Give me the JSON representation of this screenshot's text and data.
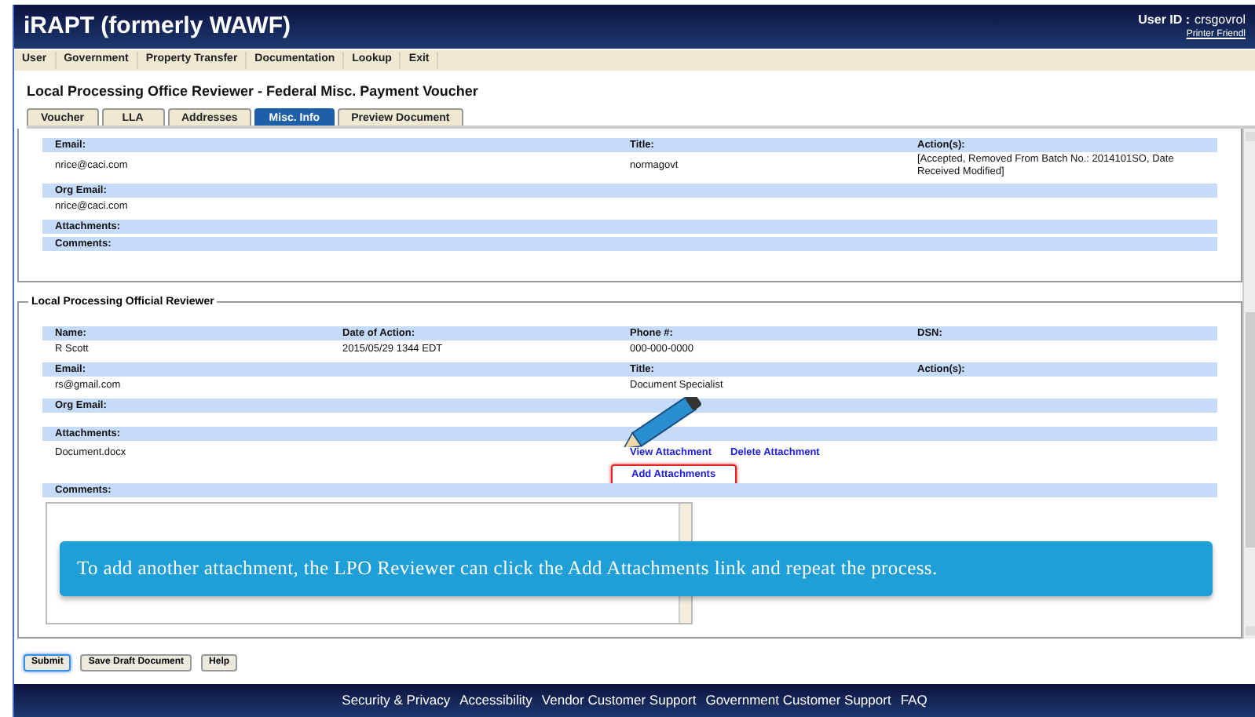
{
  "header": {
    "title": "iRAPT (formerly WAWF)",
    "user_id_label": "User ID :",
    "user_id": "crsgovrol",
    "printer_link": "Printer Friendl"
  },
  "menu": [
    "User",
    "Government",
    "Property Transfer",
    "Documentation",
    "Lookup",
    "Exit"
  ],
  "page_title": "Local Processing Office Reviewer - Federal Misc. Payment Voucher",
  "tabs": [
    {
      "label": "Voucher",
      "selected": false
    },
    {
      "label": "LLA",
      "selected": false
    },
    {
      "label": "Addresses",
      "selected": false
    },
    {
      "label": "Misc. Info",
      "selected": true
    },
    {
      "label": "Preview Document",
      "selected": false
    }
  ],
  "previous_reviewer": {
    "rows": [
      {
        "kind": "labels",
        "cells": [
          "Email:",
          null,
          "Title:",
          "Action(s):"
        ]
      },
      {
        "kind": "values",
        "cells": [
          "nrice@caci.com",
          null,
          "normagovt",
          "[Accepted, Removed From Batch No.: 2014101SO, Date Received Modified]"
        ]
      },
      {
        "kind": "labels",
        "cells": [
          "Org Email:"
        ]
      },
      {
        "kind": "values",
        "cells": [
          "nrice@caci.com"
        ]
      },
      {
        "kind": "labels",
        "cells": [
          "Attachments:"
        ]
      },
      {
        "kind": "labels",
        "cells": [
          "Comments:"
        ]
      }
    ]
  },
  "lpo_reviewer": {
    "legend": "Local Processing Official Reviewer",
    "rows": [
      {
        "kind": "labels",
        "cells": [
          "Name:",
          "Date of Action:",
          "Phone #:",
          "DSN:"
        ]
      },
      {
        "kind": "values",
        "cells": [
          "R Scott",
          "2015/05/29 1344 EDT",
          "000-000-0000"
        ]
      },
      {
        "kind": "labels",
        "cells": [
          "Email:",
          null,
          "Title:",
          "Action(s):"
        ]
      },
      {
        "kind": "values",
        "cells": [
          "rs@gmail.com",
          null,
          "Document Specialist"
        ]
      },
      {
        "kind": "labels",
        "cells": [
          "Org Email:"
        ]
      },
      {
        "kind": "empty"
      },
      {
        "kind": "labels",
        "cells": [
          "Attachments:"
        ]
      },
      {
        "kind": "attachment",
        "file": "Document.docx",
        "links": [
          "View Attachment",
          "Delete Attachment"
        ],
        "add_link": "Add Attachments",
        "highlighted": true
      },
      {
        "kind": "labels",
        "cells": [
          "Comments:"
        ]
      },
      {
        "kind": "comments"
      }
    ]
  },
  "callout": "To add another attachment, the LPO Reviewer can click the Add Attachments link and repeat the process.",
  "buttons": [
    {
      "label": "Submit",
      "selected": true
    },
    {
      "label": "Save Draft Document",
      "selected": false
    },
    {
      "label": "Help",
      "selected": false
    }
  ],
  "footer_links": [
    "Security & Privacy",
    "Accessibility",
    "Vendor Customer Support",
    "Government Customer Support",
    "FAQ"
  ]
}
